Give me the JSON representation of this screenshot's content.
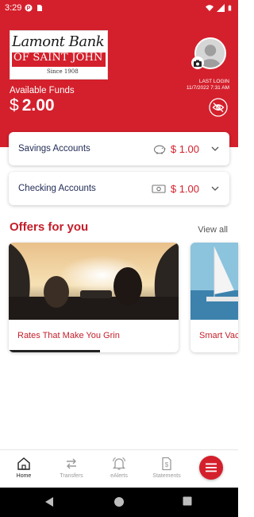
{
  "status_bar": {
    "time": "3:29"
  },
  "header": {
    "logo": {
      "line1": "Lamont Bank",
      "line2": "OF SAINT JOHN",
      "since": "Since 1908"
    },
    "last_login_label": "LAST LOGIN",
    "last_login_value": "11/7/2022 7:31 AM"
  },
  "funds": {
    "label": "Available Funds",
    "currency": "$",
    "amount": "2.00"
  },
  "accounts": [
    {
      "name": "Savings Accounts",
      "currency": "$",
      "amount": "1.00",
      "icon": "piggy-bank-icon"
    },
    {
      "name": "Checking Accounts",
      "currency": "$",
      "amount": "1.00",
      "icon": "cash-icon"
    }
  ],
  "offers": {
    "title": "Offers for you",
    "view_all": "View all",
    "items": [
      {
        "title": "Rates That Make You Grin"
      },
      {
        "title": "Smart Vac"
      }
    ]
  },
  "bottom_nav": {
    "items": [
      {
        "label": "Home",
        "icon": "home-icon",
        "active": true
      },
      {
        "label": "Transfers",
        "icon": "transfer-icon",
        "active": false
      },
      {
        "label": "eAlerts",
        "icon": "bell-icon",
        "active": false
      },
      {
        "label": "Statements",
        "icon": "statement-icon",
        "active": false
      }
    ],
    "menu_icon": "hamburger-menu-icon"
  },
  "colors": {
    "brand_red": "#d4202c",
    "navy": "#1f2a55"
  }
}
